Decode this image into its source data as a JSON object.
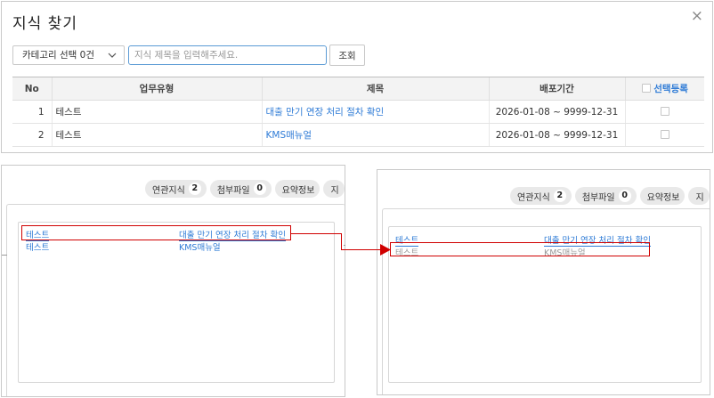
{
  "dialog": {
    "title": "지식 찾기",
    "close_glyph": "×",
    "category_select": "카테고리 선택 0건",
    "search_placeholder": "지식 제목을 입력해주세요.",
    "search_button": "조회",
    "table": {
      "headers": [
        "No",
        "업무유형",
        "제목",
        "배포기간",
        "선택등록"
      ],
      "rows": [
        {
          "no": "1",
          "type": "테스트",
          "title": "대출 만기 연장 처리 절차 확인",
          "period": "2026-01-08 ~ 9999-12-31"
        },
        {
          "no": "2",
          "type": "테스트",
          "title": "KMS매뉴얼",
          "period": "2026-01-08 ~ 9999-12-31"
        }
      ]
    }
  },
  "panel_left": {
    "tabs": [
      {
        "label": "연관지식",
        "count": "2"
      },
      {
        "label": "첨부파일",
        "count": "0"
      },
      {
        "label": "요약정보"
      },
      {
        "label": "지"
      }
    ],
    "related": [
      {
        "type": "테스트",
        "title": "대출 만기 연장 처리 절차 확인"
      },
      {
        "type": "테스트",
        "title": "KMS매뉴얼"
      }
    ]
  },
  "panel_right": {
    "tabs": [
      {
        "label": "연관지식",
        "count": "2"
      },
      {
        "label": "첨부파일",
        "count": "0"
      },
      {
        "label": "요약정보"
      },
      {
        "label": "지"
      }
    ],
    "related": [
      {
        "type": "테스트",
        "title": "대출 만기 연장 처리 절차 확인"
      },
      {
        "type": "테스트",
        "title": "KMS매뉴얼"
      }
    ]
  },
  "colors": {
    "link": "#2e7bd6",
    "highlight": "#d00000",
    "muted": "#9a9a9a"
  }
}
